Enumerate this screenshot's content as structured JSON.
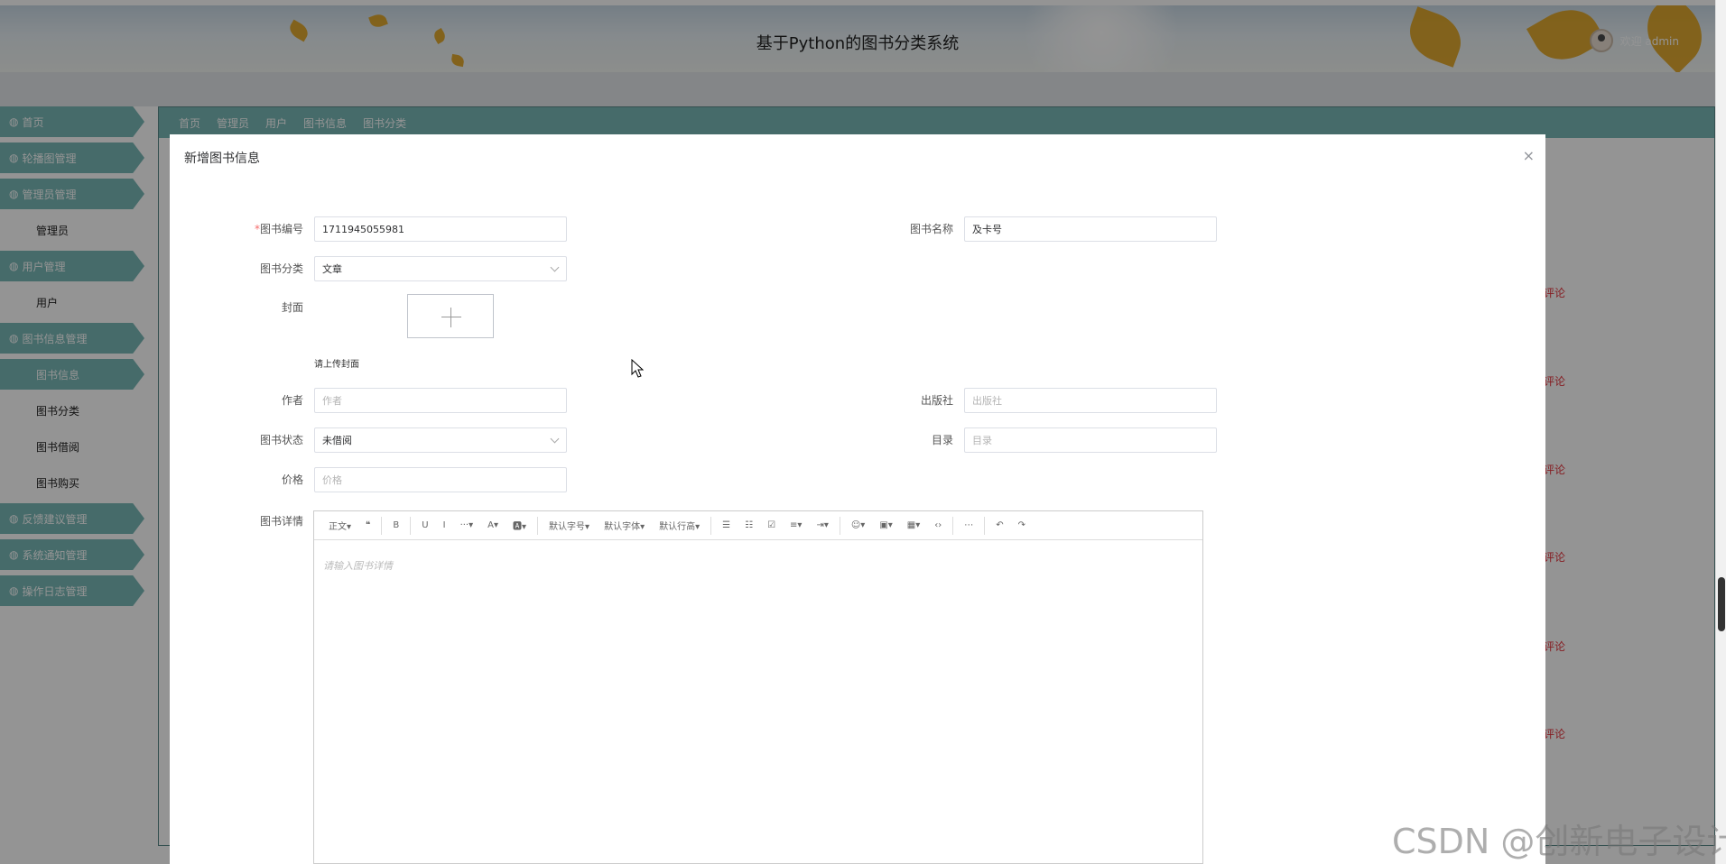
{
  "header": {
    "title": "基于Python的图书分类系统",
    "welcome": "欢迎 admin"
  },
  "sidebar": {
    "items": [
      {
        "icon": "home-icon",
        "label": "首页",
        "type": "top"
      },
      {
        "icon": "gear-icon",
        "label": "轮播图管理",
        "type": "top"
      },
      {
        "icon": "gear-icon",
        "label": "管理员管理",
        "type": "top"
      },
      {
        "label": "管理员",
        "type": "sub"
      },
      {
        "icon": "user-icon",
        "label": "用户管理",
        "type": "top"
      },
      {
        "label": "用户",
        "type": "sub"
      },
      {
        "icon": "bank-icon",
        "label": "图书信息管理",
        "type": "top"
      },
      {
        "label": "图书信息",
        "type": "sub-active"
      },
      {
        "label": "图书分类",
        "type": "sub"
      },
      {
        "label": "图书借阅",
        "type": "sub"
      },
      {
        "label": "图书购买",
        "type": "sub"
      },
      {
        "icon": "bank-icon",
        "label": "反馈建议管理",
        "type": "top"
      },
      {
        "icon": "grid-icon",
        "label": "系统通知管理",
        "type": "top"
      },
      {
        "icon": "bank-icon",
        "label": "操作日志管理",
        "type": "top"
      }
    ]
  },
  "tabs": [
    "首页",
    "管理员",
    "用户",
    "图书信息",
    "图书分类"
  ],
  "comment_label": "评论",
  "modal": {
    "title": "新增图书信息",
    "close": "×",
    "fields": {
      "book_no": {
        "label": "图书编号",
        "value": "1711945055981"
      },
      "book_name": {
        "label": "图书名称",
        "value": "及卡号"
      },
      "category": {
        "label": "图书分类",
        "value": "文章"
      },
      "cover": {
        "label": "封面",
        "hint": "请上传封面"
      },
      "author": {
        "label": "作者",
        "placeholder": "作者"
      },
      "publisher": {
        "label": "出版社",
        "placeholder": "出版社"
      },
      "status": {
        "label": "图书状态",
        "value": "未借阅"
      },
      "catalog": {
        "label": "目录",
        "placeholder": "目录"
      },
      "price": {
        "label": "价格",
        "placeholder": "价格"
      },
      "detail": {
        "label": "图书详情",
        "placeholder": "请输入图书详情"
      }
    },
    "toolbar": [
      "正文▾",
      "❝",
      "B",
      "U",
      "I",
      "···▾",
      "A▾",
      "🅰▾",
      "默认字号▾",
      "默认字体▾",
      "默认行高▾",
      "☰",
      "☷",
      "☑",
      "≡▾",
      "⇥▾",
      "☺▾",
      "▣▾",
      "▦▾",
      "‹›",
      "⋯",
      "↶",
      "↷"
    ]
  },
  "watermark": "CSDN @创新电子设计"
}
